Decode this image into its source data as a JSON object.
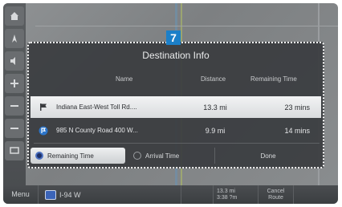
{
  "callout_number": "7",
  "panel": {
    "title": "Destination Info",
    "columns": {
      "name": "Name",
      "distance": "Distance",
      "remaining": "Remaining Time"
    },
    "rows": [
      {
        "icon": "flag-icon",
        "name": "Indiana East-West Toll Rd....",
        "distance": "13.3 mi",
        "remaining": "23 mins"
      },
      {
        "icon": "waypoint-icon",
        "name": "985 N County Road 400 W...",
        "distance": "9.9 mi",
        "remaining": "14 mins"
      }
    ],
    "options": {
      "remaining_time": "Remaining Time",
      "arrival_time": "Arrival Time",
      "done": "Done",
      "selected": "remaining_time"
    }
  },
  "bottom_bar": {
    "menu": "Menu",
    "road": "I-94 W",
    "distance_line1": "13.3 mi",
    "distance_line2": "3:38 ?m",
    "cancel_line1": "Cancel",
    "cancel_line2": "Route"
  },
  "colors": {
    "badge": "#1b7fc8",
    "panel": "#3a3c3f",
    "selected_row": "#e6e8ea"
  }
}
